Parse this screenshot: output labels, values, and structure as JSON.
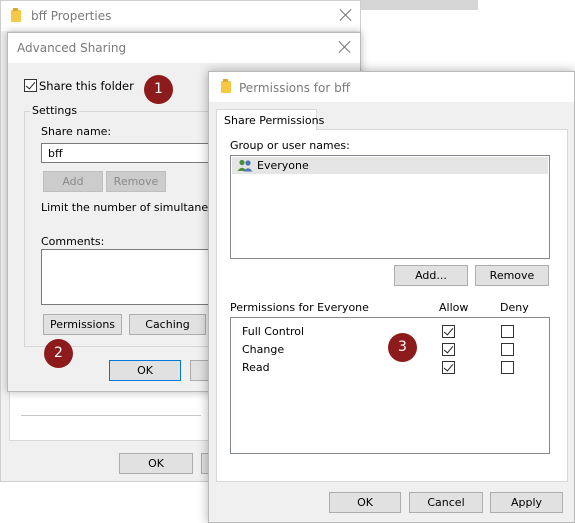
{
  "properties_window": {
    "title": "bff Properties",
    "ok_label": "OK"
  },
  "advanced_sharing": {
    "title": "Advanced Sharing",
    "share_checkbox_label": "Share this folder",
    "share_checked": true,
    "settings_label": "Settings",
    "share_name_label": "Share name:",
    "share_name_value": "bff",
    "add_label": "Add",
    "remove_label": "Remove",
    "limit_text": "Limit the number of simultaneous us",
    "comments_label": "Comments:",
    "permissions_label": "Permissions",
    "caching_label": "Caching",
    "ok_label": "OK"
  },
  "permissions_dialog": {
    "title": "Permissions for bff",
    "tab_label": "Share Permissions",
    "group_label": "Group or user names:",
    "users": [
      {
        "name": "Everyone",
        "icon": "users-icon"
      }
    ],
    "add_label": "Add...",
    "remove_label": "Remove",
    "perms_for_label": "Permissions for Everyone",
    "allow_header": "Allow",
    "deny_header": "Deny",
    "permissions": [
      {
        "name": "Full Control",
        "allow": true,
        "deny": false
      },
      {
        "name": "Change",
        "allow": true,
        "deny": false
      },
      {
        "name": "Read",
        "allow": true,
        "deny": false
      }
    ],
    "ok_label": "OK",
    "cancel_label": "Cancel",
    "apply_label": "Apply"
  },
  "markers": [
    "1",
    "2",
    "3"
  ],
  "colors": {
    "marker": "#8e1b1b",
    "selection": "#e5e5e5",
    "accent": "#0078d7",
    "folder": "#f6c945"
  }
}
